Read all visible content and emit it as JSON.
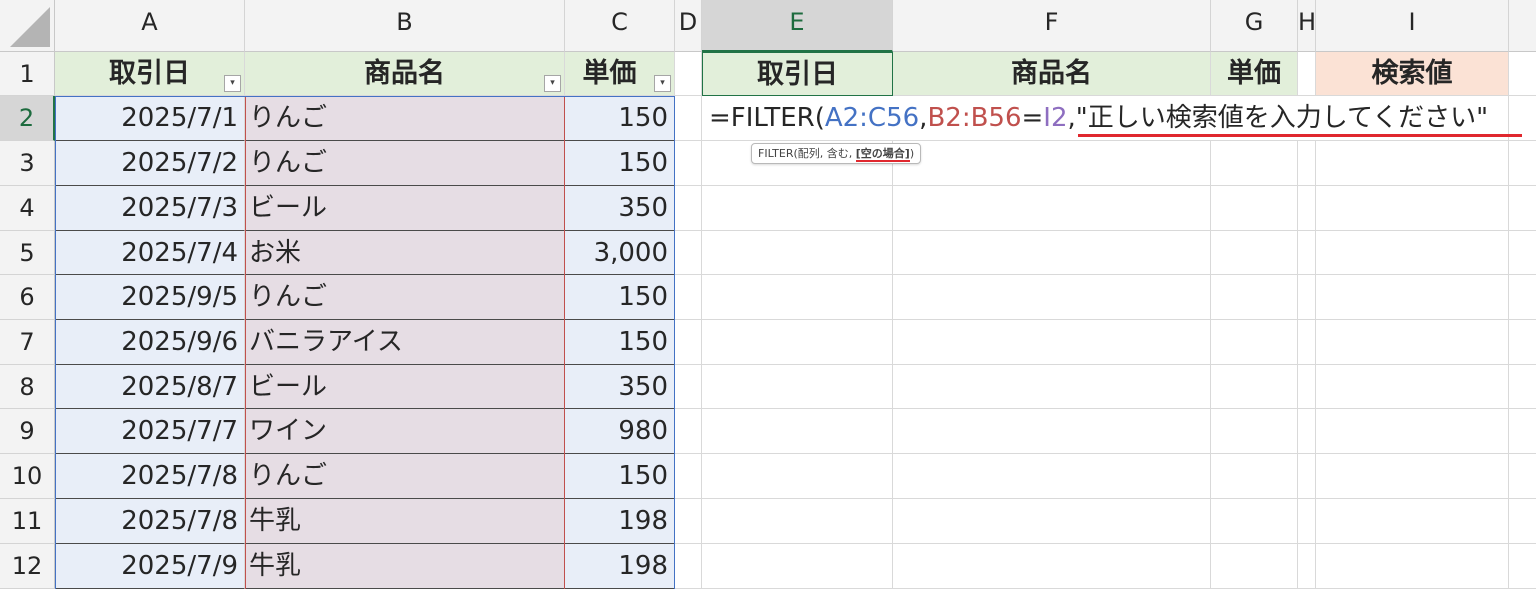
{
  "column_headers": [
    "A",
    "B",
    "C",
    "D",
    "E",
    "F",
    "G",
    "H",
    "I"
  ],
  "selected_column": "E",
  "selected_row": "2",
  "row_numbers": [
    "1",
    "2",
    "3",
    "4",
    "5",
    "6",
    "7",
    "8",
    "9",
    "10",
    "11",
    "12"
  ],
  "table_headers": {
    "date": "取引日",
    "product": "商品名",
    "price": "単価"
  },
  "filter_dropdown_icon": "dropdown-arrow-icon",
  "rows": [
    {
      "date": "2025/7/1",
      "product": "りんご",
      "price": "150"
    },
    {
      "date": "2025/7/2",
      "product": "りんご",
      "price": "150"
    },
    {
      "date": "2025/7/3",
      "product": "ビール",
      "price": "350"
    },
    {
      "date": "2025/7/4",
      "product": "お米",
      "price": "3,000"
    },
    {
      "date": "2025/9/5",
      "product": "りんご",
      "price": "150"
    },
    {
      "date": "2025/9/6",
      "product": "バニラアイス",
      "price": "150"
    },
    {
      "date": "2025/8/7",
      "product": "ビール",
      "price": "350"
    },
    {
      "date": "2025/7/7",
      "product": "ワイン",
      "price": "980"
    },
    {
      "date": "2025/7/8",
      "product": "りんご",
      "price": "150"
    },
    {
      "date": "2025/7/8",
      "product": "牛乳",
      "price": "198"
    },
    {
      "date": "2025/7/9",
      "product": "牛乳",
      "price": "198"
    }
  ],
  "result_headers": {
    "date": "取引日",
    "product": "商品名",
    "price": "単価"
  },
  "search_header": "検索値",
  "formula": {
    "prefix": "=FILTER(",
    "arg1": "A2:C56",
    "comma1": ",",
    "arg2a": "B2:B56",
    "eq": "=",
    "arg2b": "I2",
    "comma2": ",",
    "arg3": "\"正しい検索値を入力してください\""
  },
  "tooltip": {
    "text": "FILTER(配列, 含む, ",
    "bold": "[空の場合]",
    "close": ")"
  },
  "colors": {
    "ref_blue": "#4472c4",
    "ref_red": "#c0504d",
    "ref_purple": "#8e6ec0",
    "header_green": "#e2efda",
    "search_header_fill": "#fbe2d5",
    "col_a_fill": "#e8eef8",
    "col_b_fill": "#e6dde4",
    "underline_red": "#e0282e"
  }
}
